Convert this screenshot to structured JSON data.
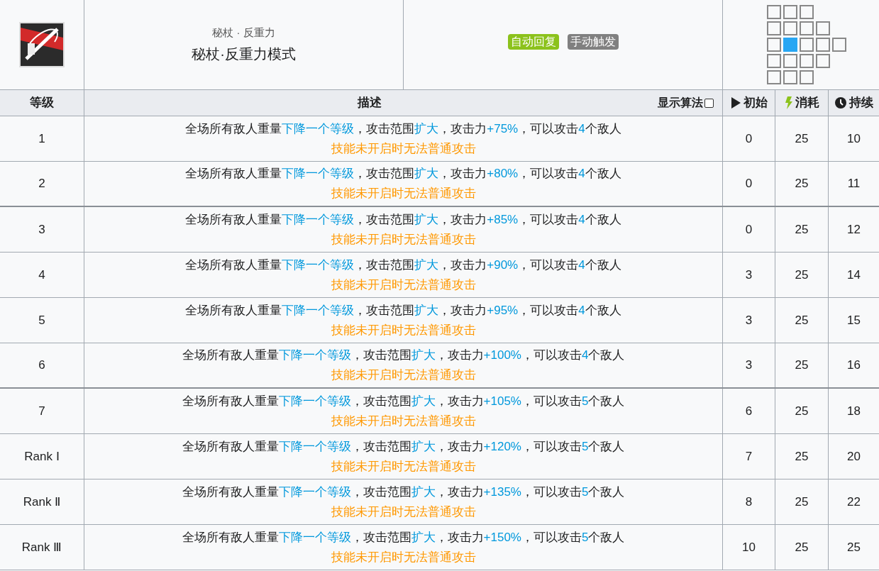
{
  "skill": {
    "subtitle": "秘杖 · 反重力",
    "name": "秘杖·反重力模式"
  },
  "tags": [
    {
      "text": "自动回复",
      "color": "#8cc21c"
    },
    {
      "text": "手动触发",
      "color": "#808080"
    }
  ],
  "range": [
    [
      {
        "kind": "cell"
      },
      {
        "kind": "cell"
      },
      {
        "kind": "cell"
      }
    ],
    [
      {
        "kind": "cell"
      },
      {
        "kind": "cell"
      },
      {
        "kind": "cell"
      },
      {
        "kind": "cell"
      }
    ],
    [
      {
        "kind": "cell"
      },
      {
        "kind": "self"
      },
      {
        "kind": "cell"
      },
      {
        "kind": "cell"
      },
      {
        "kind": "cell"
      }
    ],
    [
      {
        "kind": "cell"
      },
      {
        "kind": "cell"
      },
      {
        "kind": "cell"
      },
      {
        "kind": "cell"
      }
    ],
    [
      {
        "kind": "cell"
      },
      {
        "kind": "cell"
      },
      {
        "kind": "cell"
      }
    ]
  ],
  "columns": {
    "level": "等级",
    "description": "描述",
    "show_formula": {
      "label": "显示算法",
      "checked": false
    },
    "initial": "初始",
    "cost": "消耗",
    "duration": "持续"
  },
  "rows": [
    {
      "level": "1",
      "description": [
        {
          "text": "全场所有敌人重量",
          "kind": "plain"
        },
        {
          "text": "下降一个等级",
          "kind": "highlight"
        },
        {
          "text": "，攻击范围",
          "kind": "plain"
        },
        {
          "text": "扩大",
          "kind": "highlight"
        },
        {
          "text": "，攻击力",
          "kind": "plain"
        },
        {
          "text": "+75%",
          "kind": "highlight"
        },
        {
          "text": "，可以攻击",
          "kind": "plain"
        },
        {
          "text": "4",
          "kind": "highlight"
        },
        {
          "text": "个敌人",
          "kind": "plain"
        }
      ],
      "note": "技能未开启时无法普通攻击",
      "initial": "0",
      "cost": "25",
      "duration": "10",
      "group_end": false
    },
    {
      "level": "2",
      "description": [
        {
          "text": "全场所有敌人重量",
          "kind": "plain"
        },
        {
          "text": "下降一个等级",
          "kind": "highlight"
        },
        {
          "text": "，攻击范围",
          "kind": "plain"
        },
        {
          "text": "扩大",
          "kind": "highlight"
        },
        {
          "text": "，攻击力",
          "kind": "plain"
        },
        {
          "text": "+80%",
          "kind": "highlight"
        },
        {
          "text": "，可以攻击",
          "kind": "plain"
        },
        {
          "text": "4",
          "kind": "highlight"
        },
        {
          "text": "个敌人",
          "kind": "plain"
        }
      ],
      "note": "技能未开启时无法普通攻击",
      "initial": "0",
      "cost": "25",
      "duration": "11",
      "group_end": true
    },
    {
      "level": "3",
      "description": [
        {
          "text": "全场所有敌人重量",
          "kind": "plain"
        },
        {
          "text": "下降一个等级",
          "kind": "highlight"
        },
        {
          "text": "，攻击范围",
          "kind": "plain"
        },
        {
          "text": "扩大",
          "kind": "highlight"
        },
        {
          "text": "，攻击力",
          "kind": "plain"
        },
        {
          "text": "+85%",
          "kind": "highlight"
        },
        {
          "text": "，可以攻击",
          "kind": "plain"
        },
        {
          "text": "4",
          "kind": "highlight"
        },
        {
          "text": "个敌人",
          "kind": "plain"
        }
      ],
      "note": "技能未开启时无法普通攻击",
      "initial": "0",
      "cost": "25",
      "duration": "12",
      "group_end": false
    },
    {
      "level": "4",
      "description": [
        {
          "text": "全场所有敌人重量",
          "kind": "plain"
        },
        {
          "text": "下降一个等级",
          "kind": "highlight"
        },
        {
          "text": "，攻击范围",
          "kind": "plain"
        },
        {
          "text": "扩大",
          "kind": "highlight"
        },
        {
          "text": "，攻击力",
          "kind": "plain"
        },
        {
          "text": "+90%",
          "kind": "highlight"
        },
        {
          "text": "，可以攻击",
          "kind": "plain"
        },
        {
          "text": "4",
          "kind": "highlight"
        },
        {
          "text": "个敌人",
          "kind": "plain"
        }
      ],
      "note": "技能未开启时无法普通攻击",
      "initial": "3",
      "cost": "25",
      "duration": "14",
      "group_end": false
    },
    {
      "level": "5",
      "description": [
        {
          "text": "全场所有敌人重量",
          "kind": "plain"
        },
        {
          "text": "下降一个等级",
          "kind": "highlight"
        },
        {
          "text": "，攻击范围",
          "kind": "plain"
        },
        {
          "text": "扩大",
          "kind": "highlight"
        },
        {
          "text": "，攻击力",
          "kind": "plain"
        },
        {
          "text": "+95%",
          "kind": "highlight"
        },
        {
          "text": "，可以攻击",
          "kind": "plain"
        },
        {
          "text": "4",
          "kind": "highlight"
        },
        {
          "text": "个敌人",
          "kind": "plain"
        }
      ],
      "note": "技能未开启时无法普通攻击",
      "initial": "3",
      "cost": "25",
      "duration": "15",
      "group_end": false
    },
    {
      "level": "6",
      "description": [
        {
          "text": "全场所有敌人重量",
          "kind": "plain"
        },
        {
          "text": "下降一个等级",
          "kind": "highlight"
        },
        {
          "text": "，攻击范围",
          "kind": "plain"
        },
        {
          "text": "扩大",
          "kind": "highlight"
        },
        {
          "text": "，攻击力",
          "kind": "plain"
        },
        {
          "text": "+100%",
          "kind": "highlight"
        },
        {
          "text": "，可以攻击",
          "kind": "plain"
        },
        {
          "text": "4",
          "kind": "highlight"
        },
        {
          "text": "个敌人",
          "kind": "plain"
        }
      ],
      "note": "技能未开启时无法普通攻击",
      "initial": "3",
      "cost": "25",
      "duration": "16",
      "group_end": true
    },
    {
      "level": "7",
      "description": [
        {
          "text": "全场所有敌人重量",
          "kind": "plain"
        },
        {
          "text": "下降一个等级",
          "kind": "highlight"
        },
        {
          "text": "，攻击范围",
          "kind": "plain"
        },
        {
          "text": "扩大",
          "kind": "highlight"
        },
        {
          "text": "，攻击力",
          "kind": "plain"
        },
        {
          "text": "+105%",
          "kind": "highlight"
        },
        {
          "text": "，可以攻击",
          "kind": "plain"
        },
        {
          "text": "5",
          "kind": "highlight"
        },
        {
          "text": "个敌人",
          "kind": "plain"
        }
      ],
      "note": "技能未开启时无法普通攻击",
      "initial": "6",
      "cost": "25",
      "duration": "18",
      "group_end": false
    },
    {
      "level": "Rank Ⅰ",
      "description": [
        {
          "text": "全场所有敌人重量",
          "kind": "plain"
        },
        {
          "text": "下降一个等级",
          "kind": "highlight"
        },
        {
          "text": "，攻击范围",
          "kind": "plain"
        },
        {
          "text": "扩大",
          "kind": "highlight"
        },
        {
          "text": "，攻击力",
          "kind": "plain"
        },
        {
          "text": "+120%",
          "kind": "highlight"
        },
        {
          "text": "，可以攻击",
          "kind": "plain"
        },
        {
          "text": "5",
          "kind": "highlight"
        },
        {
          "text": "个敌人",
          "kind": "plain"
        }
      ],
      "note": "技能未开启时无法普通攻击",
      "initial": "7",
      "cost": "25",
      "duration": "20",
      "group_end": false
    },
    {
      "level": "Rank Ⅱ",
      "description": [
        {
          "text": "全场所有敌人重量",
          "kind": "plain"
        },
        {
          "text": "下降一个等级",
          "kind": "highlight"
        },
        {
          "text": "，攻击范围",
          "kind": "plain"
        },
        {
          "text": "扩大",
          "kind": "highlight"
        },
        {
          "text": "，攻击力",
          "kind": "plain"
        },
        {
          "text": "+135%",
          "kind": "highlight"
        },
        {
          "text": "，可以攻击",
          "kind": "plain"
        },
        {
          "text": "5",
          "kind": "highlight"
        },
        {
          "text": "个敌人",
          "kind": "plain"
        }
      ],
      "note": "技能未开启时无法普通攻击",
      "initial": "8",
      "cost": "25",
      "duration": "22",
      "group_end": false
    },
    {
      "level": "Rank Ⅲ",
      "description": [
        {
          "text": "全场所有敌人重量",
          "kind": "plain"
        },
        {
          "text": "下降一个等级",
          "kind": "highlight"
        },
        {
          "text": "，攻击范围",
          "kind": "plain"
        },
        {
          "text": "扩大",
          "kind": "highlight"
        },
        {
          "text": "，攻击力",
          "kind": "plain"
        },
        {
          "text": "+150%",
          "kind": "highlight"
        },
        {
          "text": "，可以攻击",
          "kind": "plain"
        },
        {
          "text": "5",
          "kind": "highlight"
        },
        {
          "text": "个敌人",
          "kind": "plain"
        }
      ],
      "note": "技能未开启时无法普通攻击",
      "initial": "10",
      "cost": "25",
      "duration": "25",
      "group_end": false
    }
  ]
}
